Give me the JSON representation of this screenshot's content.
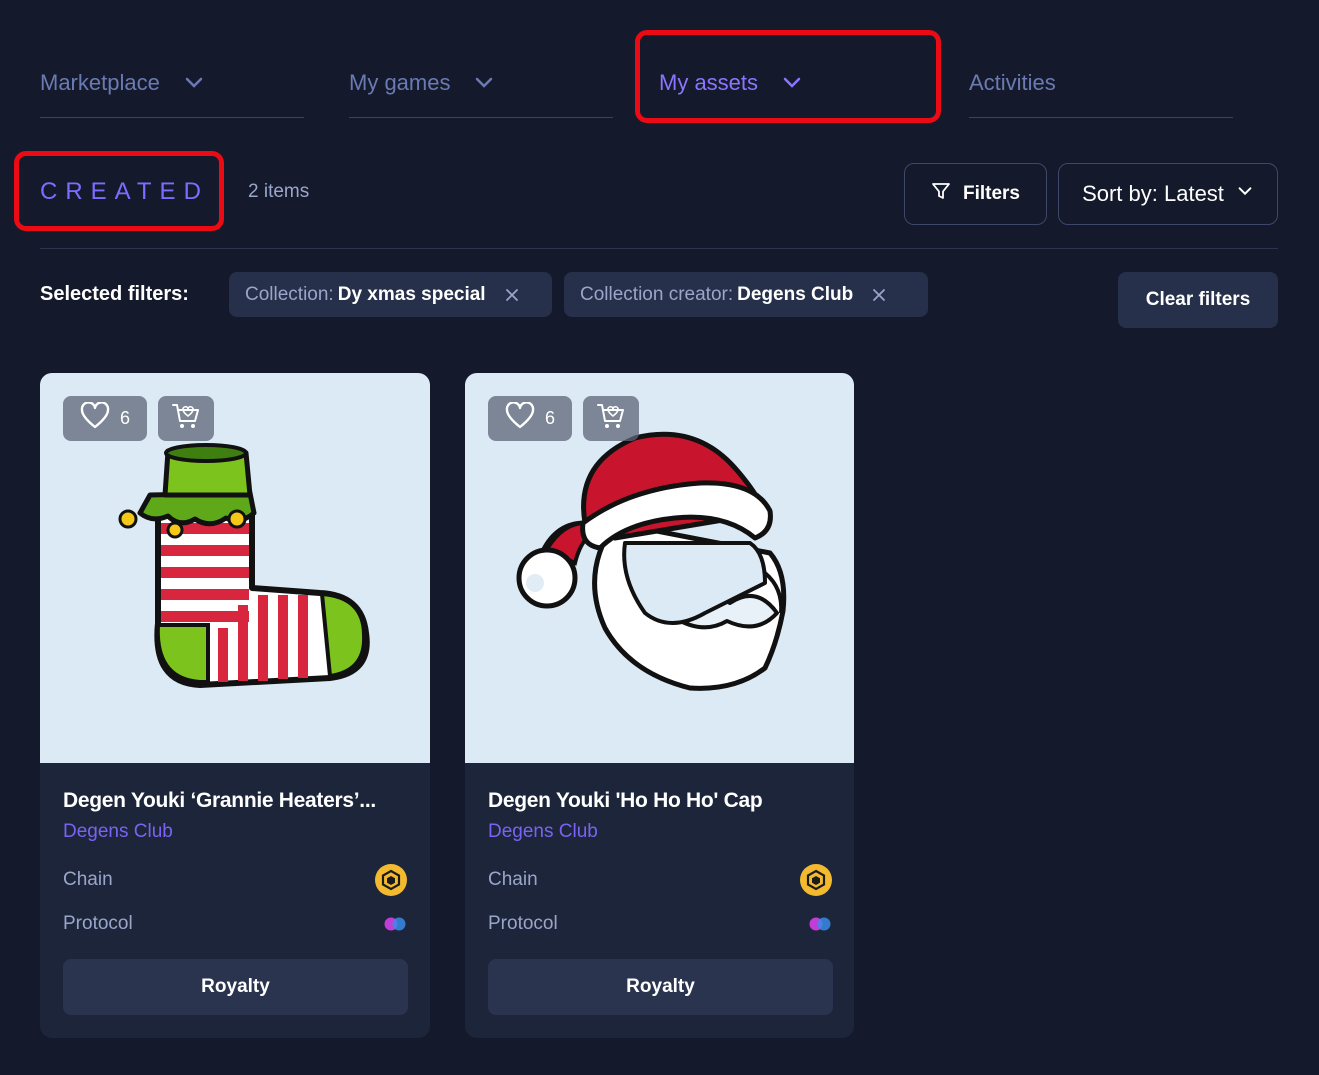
{
  "nav": {
    "items": [
      {
        "label": "Marketplace"
      },
      {
        "label": "My games"
      },
      {
        "label": "My assets"
      },
      {
        "label": "Activities"
      }
    ]
  },
  "section": {
    "title": "CREATED",
    "count": "2 items"
  },
  "toolbar": {
    "filters_label": "Filters",
    "sort_label": "Sort by: Latest"
  },
  "filters": {
    "label": "Selected filters:",
    "chips": [
      {
        "key": "Collection:",
        "value": "Dy xmas special"
      },
      {
        "key": "Collection creator:",
        "value": "Degens Club"
      }
    ],
    "clear_label": "Clear filters"
  },
  "cards": [
    {
      "title": "Degen Youki ‘Grannie Heaters’...",
      "creator": "Degens Club",
      "likes": "6",
      "chain_label": "Chain",
      "protocol_label": "Protocol",
      "button_label": "Royalty"
    },
    {
      "title": "Degen Youki 'Ho Ho Ho' Cap",
      "creator": "Degens Club",
      "likes": "6",
      "chain_label": "Chain",
      "protocol_label": "Protocol",
      "button_label": "Royalty"
    }
  ],
  "colors": {
    "accent": "#8b74ff",
    "highlight": "#ea0b14",
    "background": "#141a2b"
  },
  "icons": [
    "chevron-down-icon",
    "filter-icon",
    "close-icon",
    "heart-icon",
    "cart-icon",
    "bnb-chain-icon",
    "protocol-icon"
  ]
}
